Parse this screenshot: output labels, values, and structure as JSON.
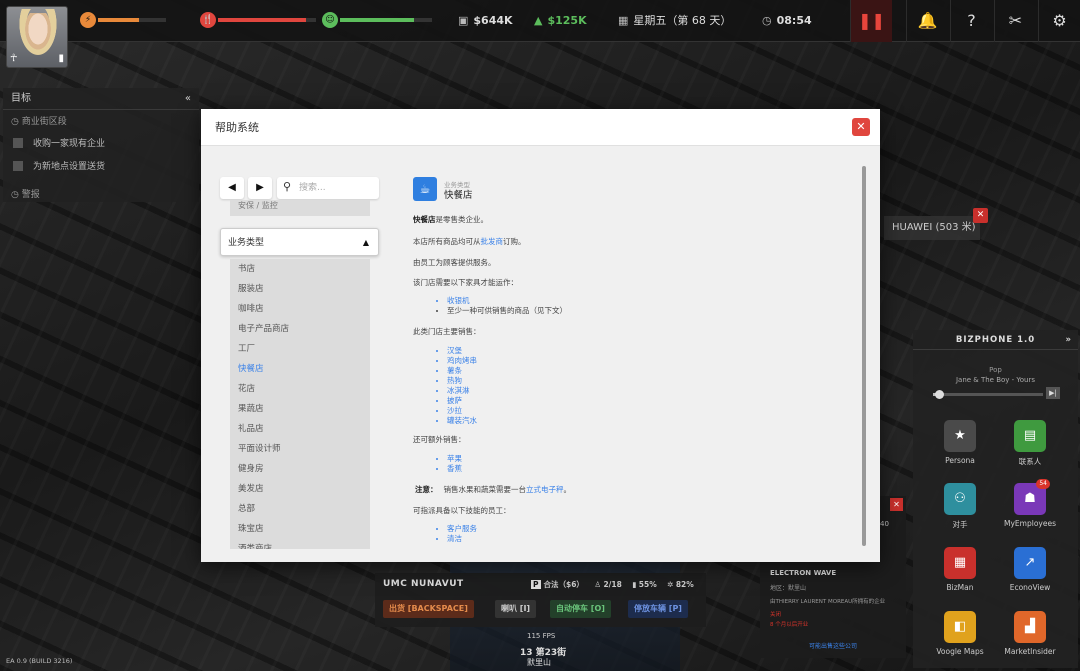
{
  "topbar": {
    "meters": [
      {
        "icon": "energy-icon",
        "glyph": "⚡",
        "color": "#e8893a",
        "fill": 0.6
      },
      {
        "icon": "hunger-icon",
        "glyph": "🍴",
        "color": "#e0463e",
        "fill": 0.9
      },
      {
        "icon": "happiness-icon",
        "glyph": "☺",
        "color": "#5cbd5c",
        "fill": 0.8
      }
    ],
    "cash": "$644K",
    "income": "$125K",
    "date": "星期五（第 68 天）",
    "time": "08:54",
    "pause": "❚❚",
    "buttons": {
      "notifications": "🔔",
      "help": "?",
      "tools": "✂",
      "settings": "⚙"
    }
  },
  "objectives": {
    "title": "目标",
    "collapse": "«",
    "section1": "商业街区段",
    "tasks": [
      "收购一家现有企业",
      "为新地点设置送货"
    ],
    "section2": "警报"
  },
  "help": {
    "title": "帮助系统",
    "close": "✕",
    "back": "◀",
    "forward": "▶",
    "search_placeholder": "搜索...",
    "scroll_top_label": "安保 / 监控",
    "category": "业务类型",
    "topics": [
      "书店",
      "服装店",
      "咖啡店",
      "电子产品商店",
      "工厂",
      "快餐店",
      "花店",
      "果蔬店",
      "礼品店",
      "平面设计师",
      "健身房",
      "美发店",
      "总部",
      "珠宝店",
      "酒类商店"
    ],
    "active_topic": "快餐店",
    "article": {
      "category": "业务类型",
      "title": "快餐店",
      "intro_bold": "快餐店",
      "intro_rest": "是零售类企业。",
      "buy_pre": "本店所有商品均可从",
      "buy_link": "批发商",
      "buy_post": "订购。",
      "staff": "由员工为顾客提供服务。",
      "req_heading": "该门店需要以下家具才能运作：",
      "req_items": [
        {
          "text": "收银机",
          "link": true
        },
        {
          "text": "至少一种可供销售的商品（见下文）",
          "link": false
        }
      ],
      "sells_heading": "此类门店主要销售：",
      "sells_items": [
        "汉堡",
        "鸡肉烤串",
        "薯条",
        "热狗",
        "冰淇淋",
        "披萨",
        "沙拉",
        "罐装汽水"
      ],
      "extra_heading": "还可额外销售：",
      "extra_items": [
        "苹果",
        "香蕉"
      ],
      "note_label": "注意：",
      "note_pre": "销售水果和蔬菜需要一台",
      "note_link": "立式电子秤",
      "note_post": "。",
      "skills_heading": "可指派具备以下技能的员工：",
      "skills_items": [
        "客户服务",
        "清洁"
      ]
    }
  },
  "map_label": {
    "text": "HUAWEI (503 米)",
    "close": "✕"
  },
  "bizphone": {
    "title": "BIZPHONE 1.0",
    "chevron": "»",
    "genre": "Pop",
    "track": "Jane & The Boy - Yours",
    "progress": 0.05,
    "skip": "▶|",
    "apps": [
      {
        "label": "Persona",
        "icon": "star-icon",
        "glyph": "★",
        "color": "#4a4a4a"
      },
      {
        "label": "联系人",
        "icon": "chat-icon",
        "glyph": "▤",
        "color": "#3f9a3f"
      },
      {
        "label": "对手",
        "icon": "people-icon",
        "glyph": "⚇",
        "color": "#2e8f9e"
      },
      {
        "label": "MyEmployees",
        "icon": "badge-icon",
        "glyph": "☗",
        "color": "#7a38b8",
        "badge": "54"
      },
      {
        "label": "BizMan",
        "icon": "store-icon",
        "glyph": "▦",
        "color": "#c9302c"
      },
      {
        "label": "EconoView",
        "icon": "chart-icon",
        "glyph": "↗",
        "color": "#2a6fd4"
      },
      {
        "label": "Voogle Maps",
        "icon": "map-icon",
        "glyph": "◧",
        "color": "#e0a21d"
      },
      {
        "label": "MarketInsider",
        "icon": "market-icon",
        "glyph": "▟",
        "color": "#e0672a"
      }
    ]
  },
  "business_panel": {
    "number": "40",
    "name": "ELECTRON WAVE",
    "location": "地区：默里山",
    "owner": "由THIERRY LAURENT MOREAU所拥有的企业",
    "note1": "关闭",
    "note2": "8 个月以后开业",
    "link": "可能出售这些公司"
  },
  "vehicle": {
    "name": "UMC NUNAVUT",
    "parking": "合法（$6）",
    "seats": "2/18",
    "fuel": "55%",
    "condition": "82%",
    "exit": "出货 [BACKSPACE]",
    "horn": "喇叭 [I]",
    "autopark": "自动停车 [O]",
    "park": "停放车辆 [P]"
  },
  "status": {
    "fps": "115 FPS",
    "street": "13 第23街",
    "district": "默里山",
    "build": "EA 0.9 (BUILD 3216)"
  }
}
